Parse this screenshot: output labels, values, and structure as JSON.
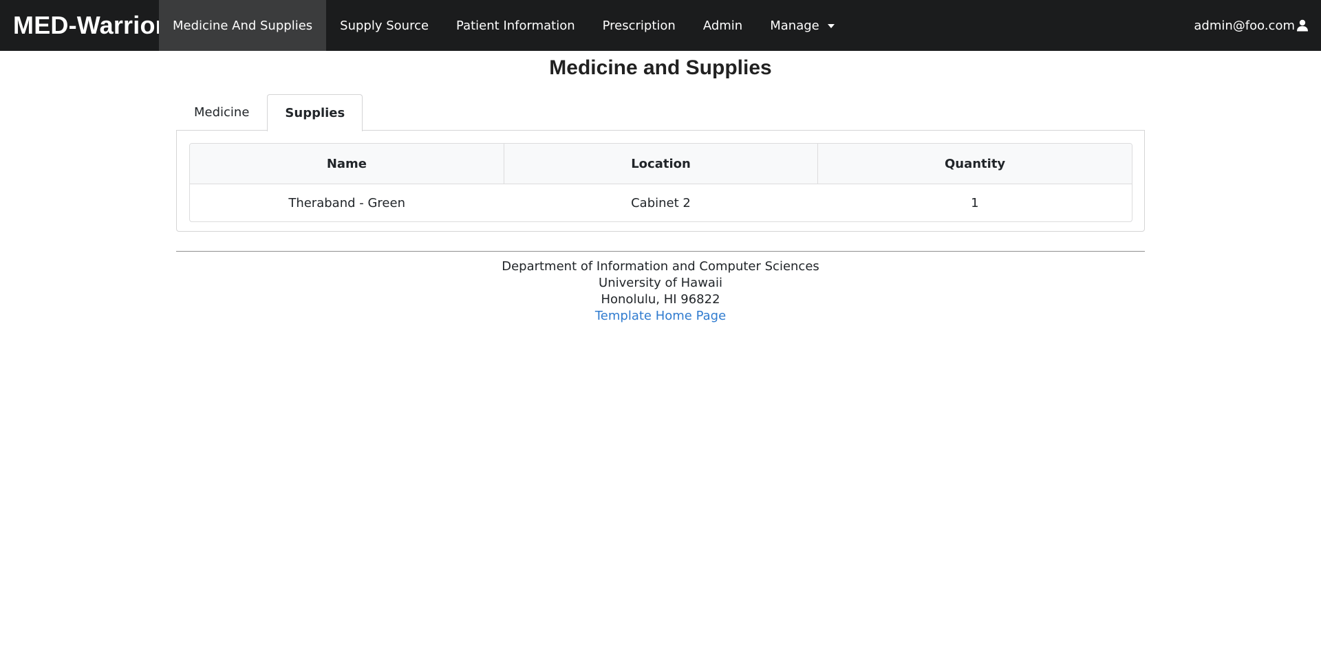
{
  "navbar": {
    "brand": "MED-Warriors",
    "items": [
      {
        "label": "Medicine And Supplies"
      },
      {
        "label": "Supply Source"
      },
      {
        "label": "Patient Information"
      },
      {
        "label": "Prescription"
      },
      {
        "label": "Admin"
      },
      {
        "label": "Manage"
      }
    ],
    "user_label": "admin@foo.com",
    "user_icon": "user-icon"
  },
  "page": {
    "title": "Medicine and Supplies"
  },
  "tabs": [
    {
      "label": "Medicine",
      "active": false
    },
    {
      "label": "Supplies",
      "active": true
    }
  ],
  "table": {
    "headers": [
      "Name",
      "Location",
      "Quantity"
    ],
    "rows": [
      [
        "Theraband - Green",
        "Cabinet 2",
        "1"
      ]
    ]
  },
  "footer": {
    "line1": "Department of Information and Computer Sciences",
    "line2": "University of Hawaii",
    "line3": "Honolulu, HI 96822",
    "link": "Template Home Page"
  },
  "colors": {
    "navbar_bg": "#1b1c1d",
    "nav_active_bg": "#3b3c3d",
    "link": "#2f7bcf"
  }
}
